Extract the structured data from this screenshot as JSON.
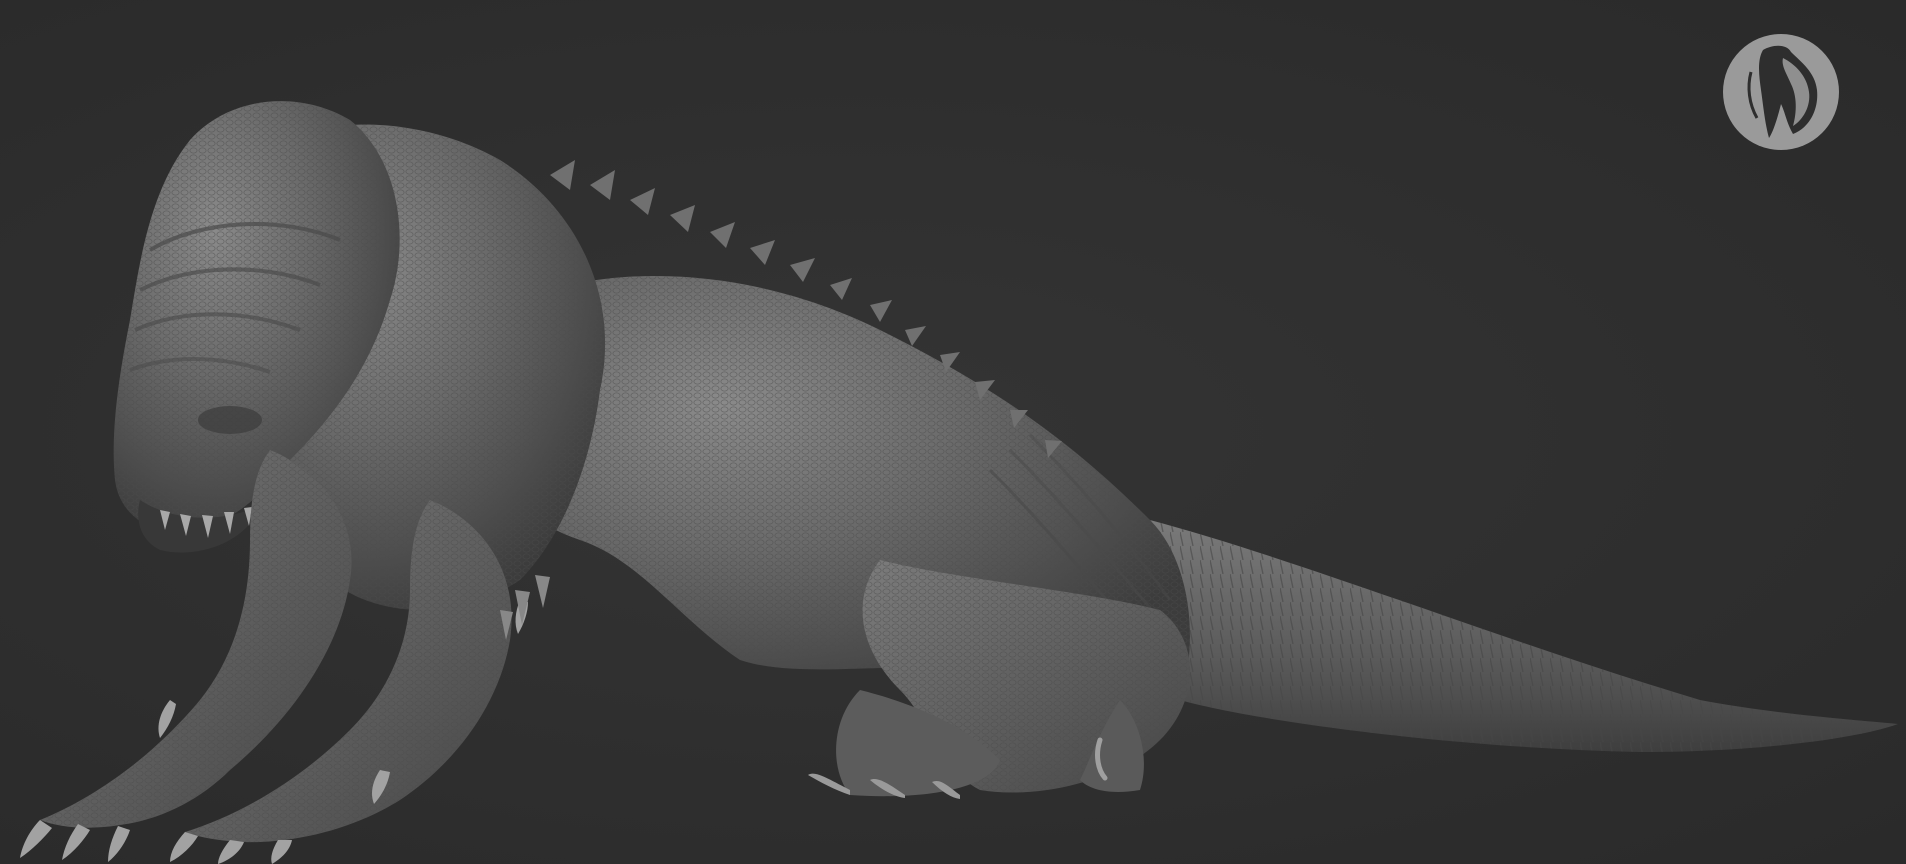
{
  "scene": {
    "background_color": "#2f2f2f",
    "subject": "sculpted-creature-render",
    "material_color": "#6b6b6b"
  },
  "logo": {
    "icon": "artist-logo-icon",
    "badge_color": "#9a9a9a"
  }
}
